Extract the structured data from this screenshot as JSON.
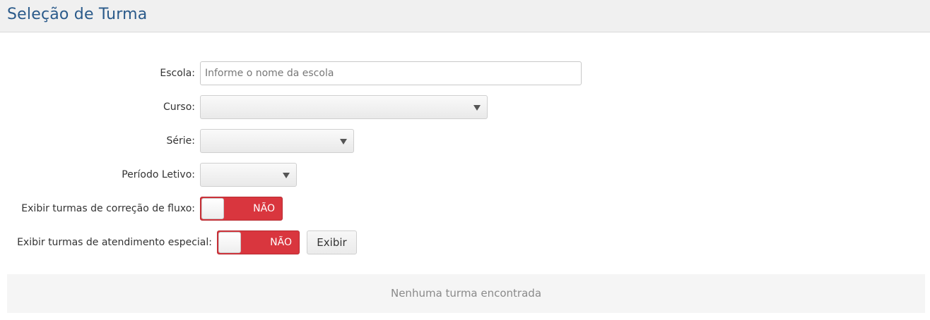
{
  "header": {
    "title": "Seleção de Turma"
  },
  "form": {
    "escola": {
      "label": "Escola:",
      "value": "",
      "placeholder": "Informe o nome da escola"
    },
    "curso": {
      "label": "Curso:",
      "selected": ""
    },
    "serie": {
      "label": "Série:",
      "selected": ""
    },
    "periodo": {
      "label": "Período Letivo:",
      "selected": ""
    },
    "correcao_fluxo": {
      "label": "Exibir turmas de correção de fluxo:",
      "state": "NÃO"
    },
    "atendimento_especial": {
      "label": "Exibir turmas de atendimento especial:",
      "state": "NÃO"
    },
    "exibir_button": "Exibir"
  },
  "results": {
    "empty_message": "Nenhuma turma encontrada"
  },
  "colors": {
    "title": "#2a5a8a",
    "toggle_off": "#d9363e"
  }
}
